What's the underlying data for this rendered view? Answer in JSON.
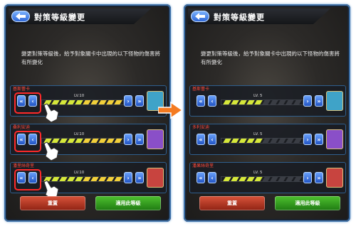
{
  "header": {
    "title": "對策等級變更"
  },
  "description": "變更對策等級後，給予對象關卡中出現的以下怪物的傷害將有所變化",
  "left": {
    "rows": [
      {
        "name": "基斯蕾卡",
        "level": "LV.10",
        "avatar_color": "#3fa3c8"
      },
      {
        "name": "桑利安迪",
        "level": "LV.10",
        "avatar_color": "#8a4fc8"
      },
      {
        "name": "潘里絲奇里",
        "level": "LV.10",
        "avatar_color": "#c8443f"
      }
    ],
    "level_fraction": 1.0
  },
  "right": {
    "rows": [
      {
        "name": "基斯蕾卡",
        "level": "LV. 5",
        "avatar_color": "#3fa3c8"
      },
      {
        "name": "多利安迪",
        "level": "LV. 5",
        "avatar_color": "#8a4fc8"
      },
      {
        "name": "潘果絲奇里",
        "level": "LV. 5",
        "avatar_color": "#c8443f"
      }
    ],
    "level_fraction": 0.5
  },
  "buttons": {
    "reset": "重置",
    "apply": "適用此等級"
  },
  "icons": {
    "back": "back-arrow-icon",
    "double_left": "double-left-icon",
    "single_left": "left-icon",
    "single_right": "right-icon",
    "double_right": "double-right-icon",
    "hand": "pointing-hand-icon",
    "transition": "orange-arrow-icon"
  },
  "colors": {
    "accent_blue": "#2a63d6",
    "highlight_red": "#ff2a2a",
    "reset_red": "#d9533a",
    "apply_green": "#4ec22f",
    "arrow_orange": "#f47a20"
  }
}
